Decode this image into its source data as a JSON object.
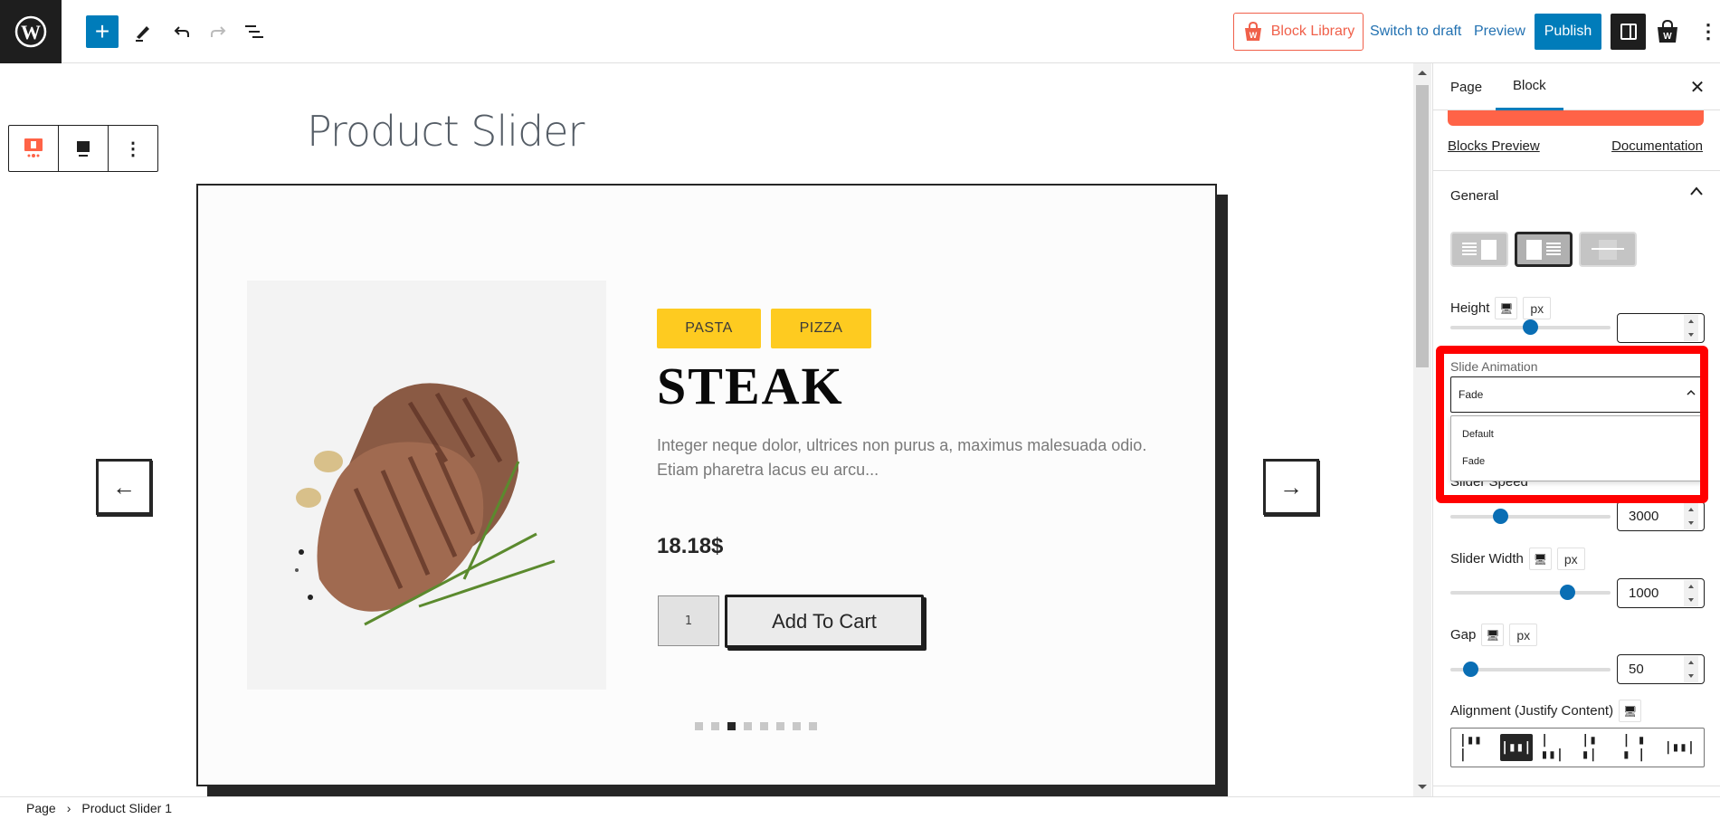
{
  "topbar": {
    "logo_icon": "wordpress-logo-icon",
    "add_block_label": "+",
    "block_library_label": "Block Library",
    "switch_to_draft_label": "Switch to draft",
    "preview_label": "Preview",
    "publish_label": "Publish",
    "more_label": "⋮"
  },
  "canvas": {
    "page_title": "Product Slider",
    "block_toolbar": {
      "more_label": "⋮"
    },
    "slider": {
      "prev_label": "←",
      "next_label": "→",
      "product": {
        "tags": [
          "PASTA",
          "PIZZA"
        ],
        "title": "STEAK",
        "description": "Integer neque dolor, ultrices non purus a, maximus malesuada odio. Etiam pharetra lacus eu arcu...",
        "price": "18.18$",
        "quantity": "1",
        "add_to_cart_label": "Add To Cart"
      },
      "dots_total": 8,
      "active_dot": 3
    }
  },
  "sidebar": {
    "tabs": [
      {
        "label": "Page",
        "active": false
      },
      {
        "label": "Block",
        "active": true
      }
    ],
    "close_label": "✕",
    "links": {
      "blocks_preview": "Blocks Preview",
      "documentation": "Documentation"
    },
    "panel": {
      "title": "General",
      "expanded": true,
      "layouts": [
        "image-right",
        "image-left",
        "image-overlay"
      ],
      "active_layout": 2,
      "height": {
        "label": "Height",
        "unit": "px",
        "value": "",
        "slider_fraction": 0.5
      },
      "slide_animation": {
        "label": "Slide Animation",
        "value": "Fade",
        "options": [
          "Default",
          "Fade"
        ]
      },
      "slider_speed": {
        "label": "Slider Speed",
        "value": "3000",
        "slider_fraction": 0.3
      },
      "slider_width": {
        "label": "Slider Width",
        "unit": "px",
        "value": "1000",
        "slider_fraction": 0.72
      },
      "gap": {
        "label": "Gap",
        "unit": "px",
        "value": "50",
        "slider_fraction": 0.12
      },
      "alignment": {
        "label": "Alignment (Justify Content)",
        "options": [
          "flex-start",
          "center",
          "flex-end",
          "space-between",
          "space-around",
          "space-evenly"
        ],
        "active_index": 2
      }
    }
  },
  "breadcrumb": {
    "items": [
      "Page",
      "Product Slider 1"
    ],
    "separator": "›"
  },
  "colors": {
    "accent": "#007cba",
    "brand_orange": "#ff6347",
    "tag_yellow": "#fecb20",
    "highlight_red": "#ff0000"
  }
}
